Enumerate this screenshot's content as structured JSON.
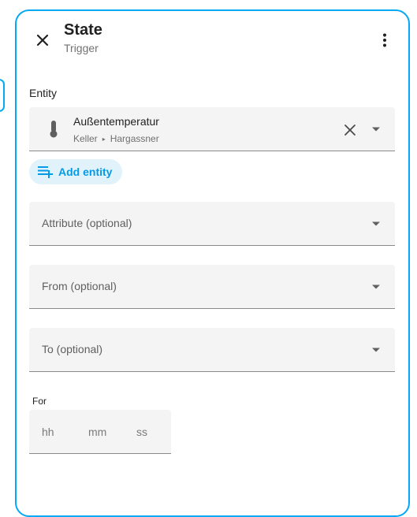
{
  "dialog": {
    "title": "State",
    "subtitle": "Trigger"
  },
  "entity": {
    "section_label": "Entity",
    "name": "Außentemperatur",
    "area": "Keller",
    "device": "Hargassner",
    "add_label": "Add entity"
  },
  "fields": {
    "attribute_label": "Attribute (optional)",
    "from_label": "From (optional)",
    "to_label": "To (optional)"
  },
  "duration": {
    "label": "For",
    "hours_placeholder": "hh",
    "minutes_placeholder": "mm",
    "seconds_placeholder": "ss"
  },
  "icons": {
    "close": "close-icon",
    "menu": "dots-vertical-icon",
    "entity": "thermometer-icon",
    "clear": "close-icon",
    "dropdown": "menu-down-icon",
    "add": "playlist-plus-icon"
  },
  "colors": {
    "accent": "#03a9f4",
    "chip_bg": "#e1f2fa",
    "chip_text": "#039be5",
    "field_bg": "#f4f4f4"
  }
}
